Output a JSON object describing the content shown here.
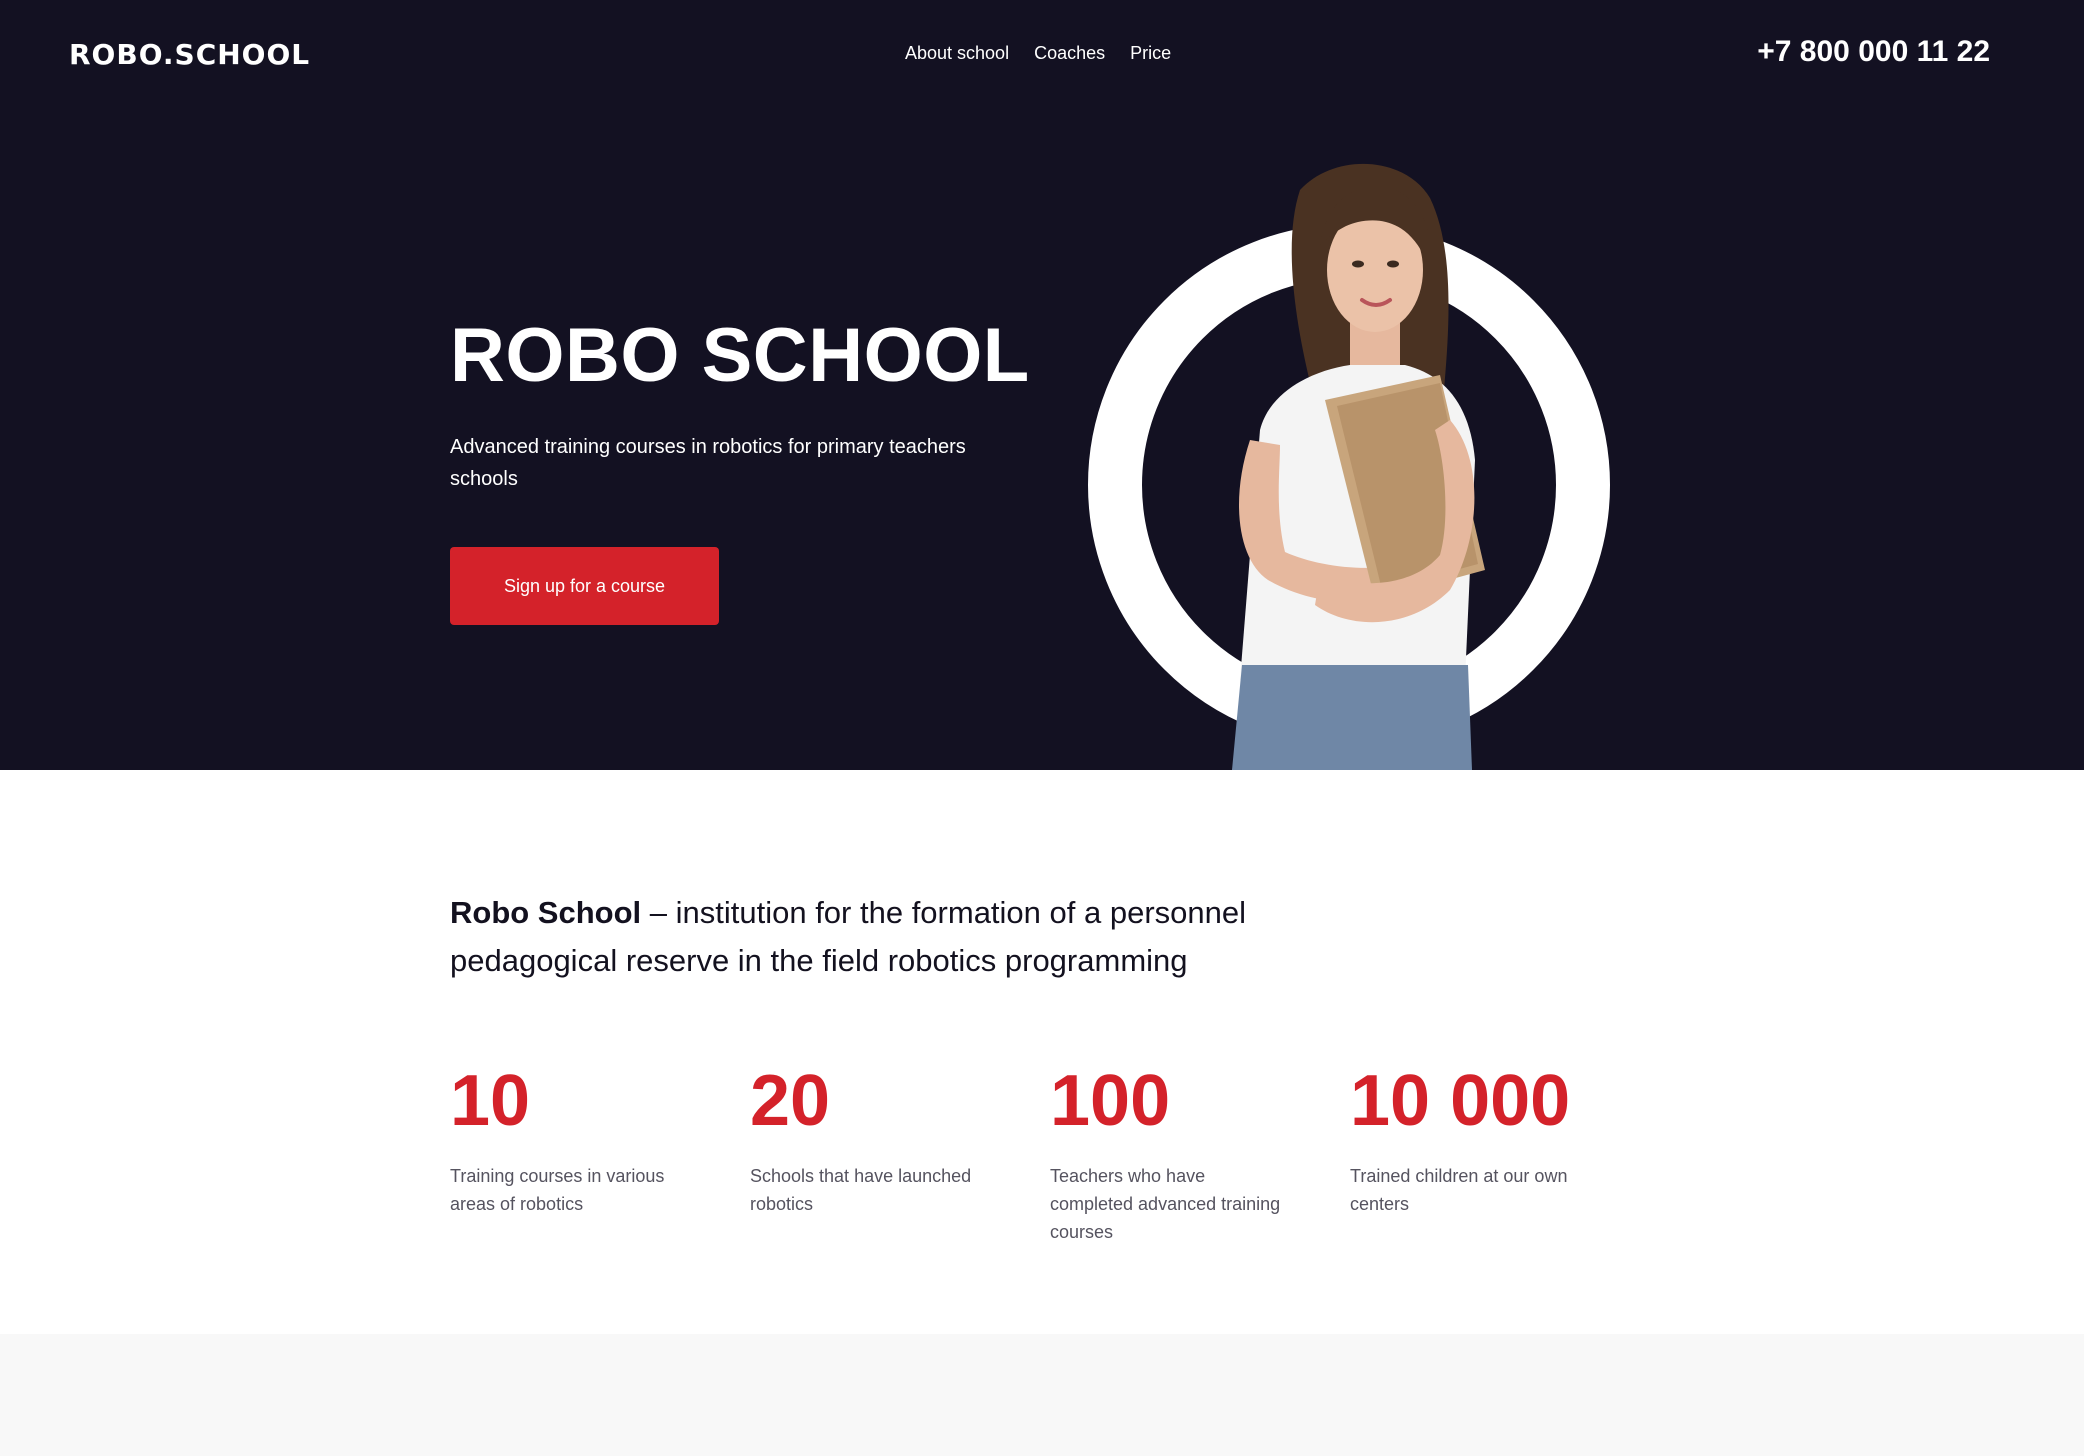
{
  "header": {
    "logo": "ROBO.SCHOOL",
    "nav": [
      "About school",
      "Coaches",
      "Price"
    ],
    "phone": "+7 800 000 11 22"
  },
  "hero": {
    "title": "ROBO SCHOOL",
    "subtitle": "Advanced training courses in robotics for primary teachers schools",
    "cta_label": "Sign up for a course"
  },
  "about": {
    "name": "Robo School",
    "text": " – institution for the formation of a personnel pedagogical reserve in the field robotics programming"
  },
  "stats": [
    {
      "number": "10",
      "label": "Training courses in various areas of robotics"
    },
    {
      "number": "20",
      "label": "Schools that have launched robotics"
    },
    {
      "number": "100",
      "label": "Teachers who have completed advanced training courses"
    },
    {
      "number": "10 000",
      "label": "Trained children at our own centers"
    }
  ],
  "colors": {
    "hero_bg": "#131122",
    "accent": "#d4222a",
    "text_dark": "#13111f",
    "muted": "#55535f"
  }
}
